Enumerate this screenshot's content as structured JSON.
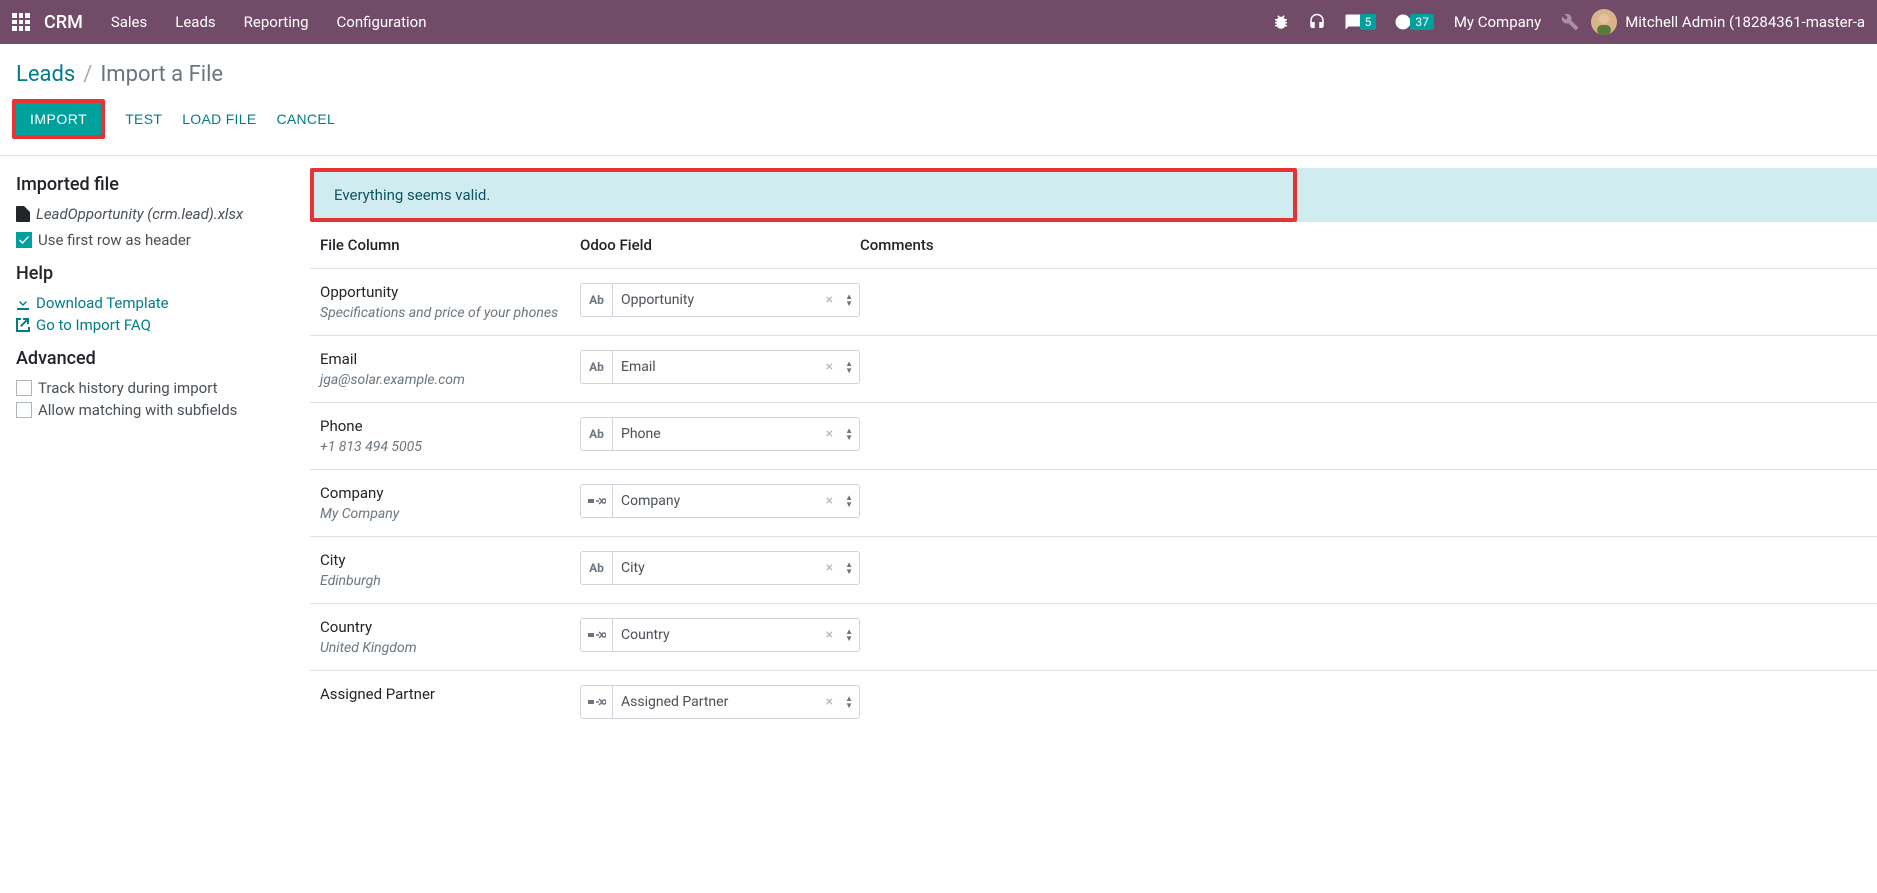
{
  "navbar": {
    "brand": "CRM",
    "menu": [
      "Sales",
      "Leads",
      "Reporting",
      "Configuration"
    ],
    "messages_badge": "5",
    "activities_badge": "37",
    "company": "My Company",
    "user": "Mitchell Admin (18284361-master-a"
  },
  "breadcrumb": {
    "parent": "Leads",
    "sep": "/",
    "current": "Import a File"
  },
  "toolbar": {
    "import": "IMPORT",
    "test": "TEST",
    "load_file": "LOAD FILE",
    "cancel": "CANCEL"
  },
  "sidebar": {
    "imported_file_heading": "Imported file",
    "filename": "LeadOpportunity (crm.lead).xlsx",
    "use_first_row_label": "Use first row as header",
    "help_heading": "Help",
    "download_template": "Download Template",
    "import_faq": "Go to Import FAQ",
    "advanced_heading": "Advanced",
    "track_history": "Track history during import",
    "allow_subfields": "Allow matching with subfields"
  },
  "validation_message": "Everything seems valid.",
  "table_headers": {
    "file_column": "File Column",
    "odoo_field": "Odoo Field",
    "comments": "Comments"
  },
  "mappings": [
    {
      "name": "Opportunity",
      "sample": "Specifications and price of your phones",
      "field": "Opportunity",
      "type": "Ab"
    },
    {
      "name": "Email",
      "sample": "jga@solar.example.com",
      "field": "Email",
      "type": "Ab"
    },
    {
      "name": "Phone",
      "sample": "+1 813 494 5005",
      "field": "Phone",
      "type": "Ab"
    },
    {
      "name": "Company",
      "sample": "My Company",
      "field": "Company",
      "type": "rel"
    },
    {
      "name": "City",
      "sample": "Edinburgh",
      "field": "City",
      "type": "Ab"
    },
    {
      "name": "Country",
      "sample": "United Kingdom",
      "field": "Country",
      "type": "rel"
    },
    {
      "name": "Assigned Partner",
      "sample": "",
      "field": "Assigned Partner",
      "type": "rel"
    }
  ]
}
